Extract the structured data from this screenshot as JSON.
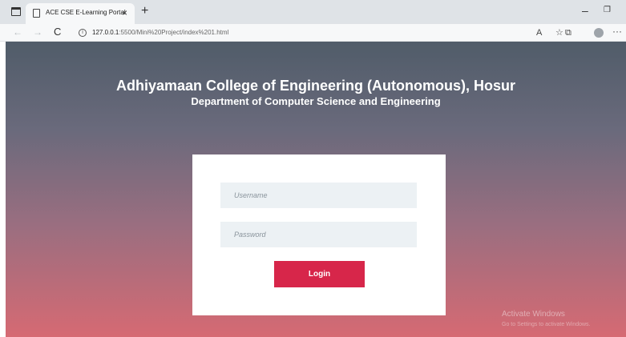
{
  "browser": {
    "tab": {
      "title": "ACE CSE E-Learning Portal",
      "close_glyph": "×"
    },
    "new_tab_glyph": "+",
    "window": {
      "minimize_glyph": "–",
      "restore_glyph": "❐"
    },
    "nav": {
      "back_glyph": "←",
      "forward_glyph": "→",
      "reload_glyph": "C",
      "info_glyph": "i"
    },
    "url": {
      "host": "127.0.0.1",
      "path": ":5500/Mini%20Project/index%201.html"
    },
    "toolbar": {
      "read_aloud_glyph": "A",
      "favorite_glyph": "☆",
      "collections_glyph": "⧉",
      "more_glyph": "···"
    }
  },
  "page": {
    "title": "Adhiyamaan College of Engineering (Autonomous), Hosur",
    "subtitle": "Department of Computer Science and Engineering"
  },
  "login": {
    "username_placeholder": "Username",
    "password_placeholder": "Password",
    "button_label": "Login"
  },
  "watermark": {
    "title": "Activate Windows",
    "subtitle": "Go to Settings to activate Windows."
  },
  "colors": {
    "button": "#d7264a",
    "field_bg": "#ecf1f4",
    "gradient_top": "#505c69",
    "gradient_bottom": "#d66a73"
  }
}
